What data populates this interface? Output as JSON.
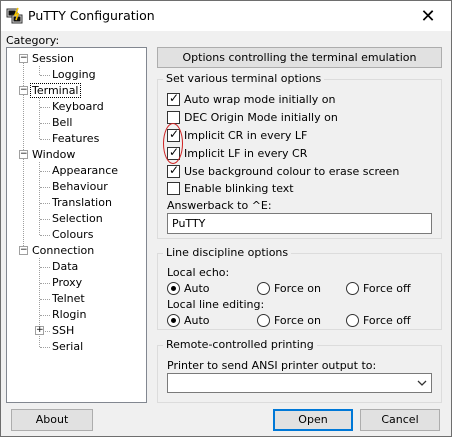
{
  "window": {
    "title": "PuTTY Configuration",
    "close_symbol": "✕"
  },
  "category_label": "Category:",
  "tree": [
    {
      "label": "Session",
      "expander": "−"
    },
    {
      "label": "Logging"
    },
    {
      "label": "Terminal",
      "expander": "−",
      "selected": true
    },
    {
      "label": "Keyboard"
    },
    {
      "label": "Bell"
    },
    {
      "label": "Features"
    },
    {
      "label": "Window",
      "expander": "−"
    },
    {
      "label": "Appearance"
    },
    {
      "label": "Behaviour"
    },
    {
      "label": "Translation"
    },
    {
      "label": "Selection"
    },
    {
      "label": "Colours"
    },
    {
      "label": "Connection",
      "expander": "−"
    },
    {
      "label": "Data"
    },
    {
      "label": "Proxy"
    },
    {
      "label": "Telnet"
    },
    {
      "label": "Rlogin"
    },
    {
      "label": "SSH",
      "expander": "+"
    },
    {
      "label": "Serial"
    }
  ],
  "panel_header": "Options controlling the terminal emulation",
  "terminal_options": {
    "title": "Set various terminal options",
    "checkboxes": [
      {
        "label": "Auto wrap mode initially on",
        "checked": true
      },
      {
        "label": "DEC Origin Mode initially on",
        "checked": false
      },
      {
        "label": "Implicit CR in every LF",
        "checked": true
      },
      {
        "label": "Implicit LF in every CR",
        "checked": true
      },
      {
        "label": "Use background colour to erase screen",
        "checked": true
      },
      {
        "label": "Enable blinking text",
        "checked": false
      }
    ],
    "answerback_label": "Answerback to ^E:",
    "answerback_value": "PuTTY"
  },
  "line_discipline": {
    "title": "Line discipline options",
    "local_echo_label": "Local echo:",
    "local_echo_options": [
      {
        "label": "Auto",
        "selected": true
      },
      {
        "label": "Force on",
        "selected": false
      },
      {
        "label": "Force off",
        "selected": false
      }
    ],
    "local_edit_label": "Local line editing:",
    "local_edit_options": [
      {
        "label": "Auto",
        "selected": true
      },
      {
        "label": "Force on",
        "selected": false
      },
      {
        "label": "Force off",
        "selected": false
      }
    ]
  },
  "remote_printing": {
    "title": "Remote-controlled printing",
    "printer_label": "Printer to send ANSI printer output to:",
    "printer_value": ""
  },
  "buttons": {
    "about": "About",
    "open": "Open",
    "cancel": "Cancel"
  },
  "colors": {
    "annotation": "#d02020",
    "default_button_border": "#0078d7"
  },
  "icons": {
    "app": "putty-app-icon",
    "close": "close-icon",
    "dropdown": "chevron-down-icon"
  }
}
